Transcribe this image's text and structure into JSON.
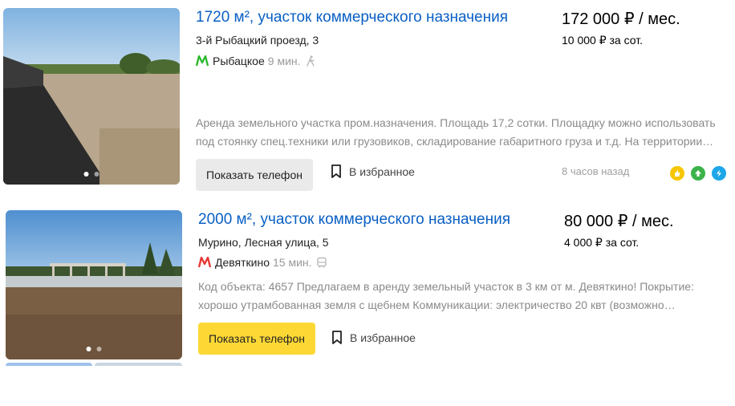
{
  "listings": [
    {
      "title": "1720 м², участок коммерческого назначения",
      "price": "172 000 ₽ / мес.",
      "per_unit": "10 000 ₽ за сот.",
      "address": "3-й Рыбацкий проезд, 3",
      "metro": {
        "station": "Рыбацкое",
        "time": "9 мин.",
        "line_color": "#2eb82e",
        "transport": "walk-icon"
      },
      "description_lines": [
        "Аренда земельного участка пром.назначения. Площадь 17,2 сотки. Площадку можно использовать",
        "под стоянку спец.техники или грузовиков, складирование габаритного груза и т.д. На территории…"
      ],
      "phone_button": "Показать телефон",
      "favorite": "В избранное",
      "time_ago": "8 часов назад",
      "badges": [
        {
          "icon": "thumbs-up-icon",
          "color": "#f7c600"
        },
        {
          "icon": "arrow-up-icon",
          "color": "#3cb34a"
        },
        {
          "icon": "lightning-icon",
          "color": "#1ca7e8"
        }
      ]
    },
    {
      "title": "2000 м², участок коммерческого назначения",
      "price": "80 000 ₽ / мес.",
      "per_unit": "4 000 ₽ за сот.",
      "address": "Мурино, Лесная улица, 5",
      "metro": {
        "station": "Девяткино",
        "time": "15 мин.",
        "line_color": "#e53935",
        "transport": "bus-icon"
      },
      "description_lines": [
        "Код объекта: 4657 Предлагаем в аренду земельный участок в 3 км от м. Девяткино! Покрытие:",
        "хорошо утрамбованная земля с щебнем Коммуникации: электричество 20 квт (возможно…"
      ],
      "phone_button": "Показать телефон",
      "favorite": "В избранное"
    }
  ]
}
